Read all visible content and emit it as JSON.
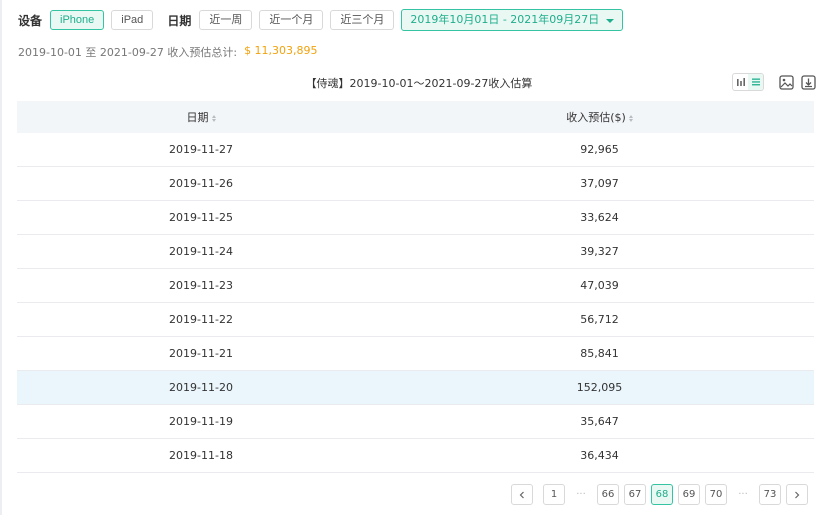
{
  "filters": {
    "device_label": "设备",
    "devices": [
      {
        "label": "iPhone",
        "active": true
      },
      {
        "label": "iPad",
        "active": false
      }
    ],
    "date_label": "日期",
    "ranges": [
      "近一周",
      "近一个月",
      "近三个月"
    ],
    "date_range": "2019年10月01日 - 2021年09月27日"
  },
  "summary": {
    "text": "2019-10-01 至 2021-09-27 收入预估总计:",
    "amount": "$ 11,303,895"
  },
  "table": {
    "title": "【侍魂】2019-10-01～2021-09-27收入估算",
    "columns": [
      "日期",
      "收入预估($)"
    ],
    "rows": [
      {
        "date": "2019-11-27",
        "revenue": "92,965"
      },
      {
        "date": "2019-11-26",
        "revenue": "37,097"
      },
      {
        "date": "2019-11-25",
        "revenue": "33,624"
      },
      {
        "date": "2019-11-24",
        "revenue": "39,327"
      },
      {
        "date": "2019-11-23",
        "revenue": "47,039"
      },
      {
        "date": "2019-11-22",
        "revenue": "56,712"
      },
      {
        "date": "2019-11-21",
        "revenue": "85,841"
      },
      {
        "date": "2019-11-20",
        "revenue": "152,095"
      },
      {
        "date": "2019-11-19",
        "revenue": "35,647"
      },
      {
        "date": "2019-11-18",
        "revenue": "36,434"
      }
    ],
    "highlighted_row": 7
  },
  "toolbar": {
    "icons": [
      "bar-chart-icon",
      "list-icon",
      "image-icon",
      "download-icon"
    ]
  },
  "pagination": {
    "first": "1",
    "pages": [
      "66",
      "67",
      "68",
      "69",
      "70"
    ],
    "current": "68",
    "last": "73",
    "ellipsis": "···"
  },
  "colors": {
    "accent": "#34c3a3",
    "accent_text": "#1fae8c",
    "amount": "#f2a20d",
    "highlight_row": "#eaf6fc"
  }
}
